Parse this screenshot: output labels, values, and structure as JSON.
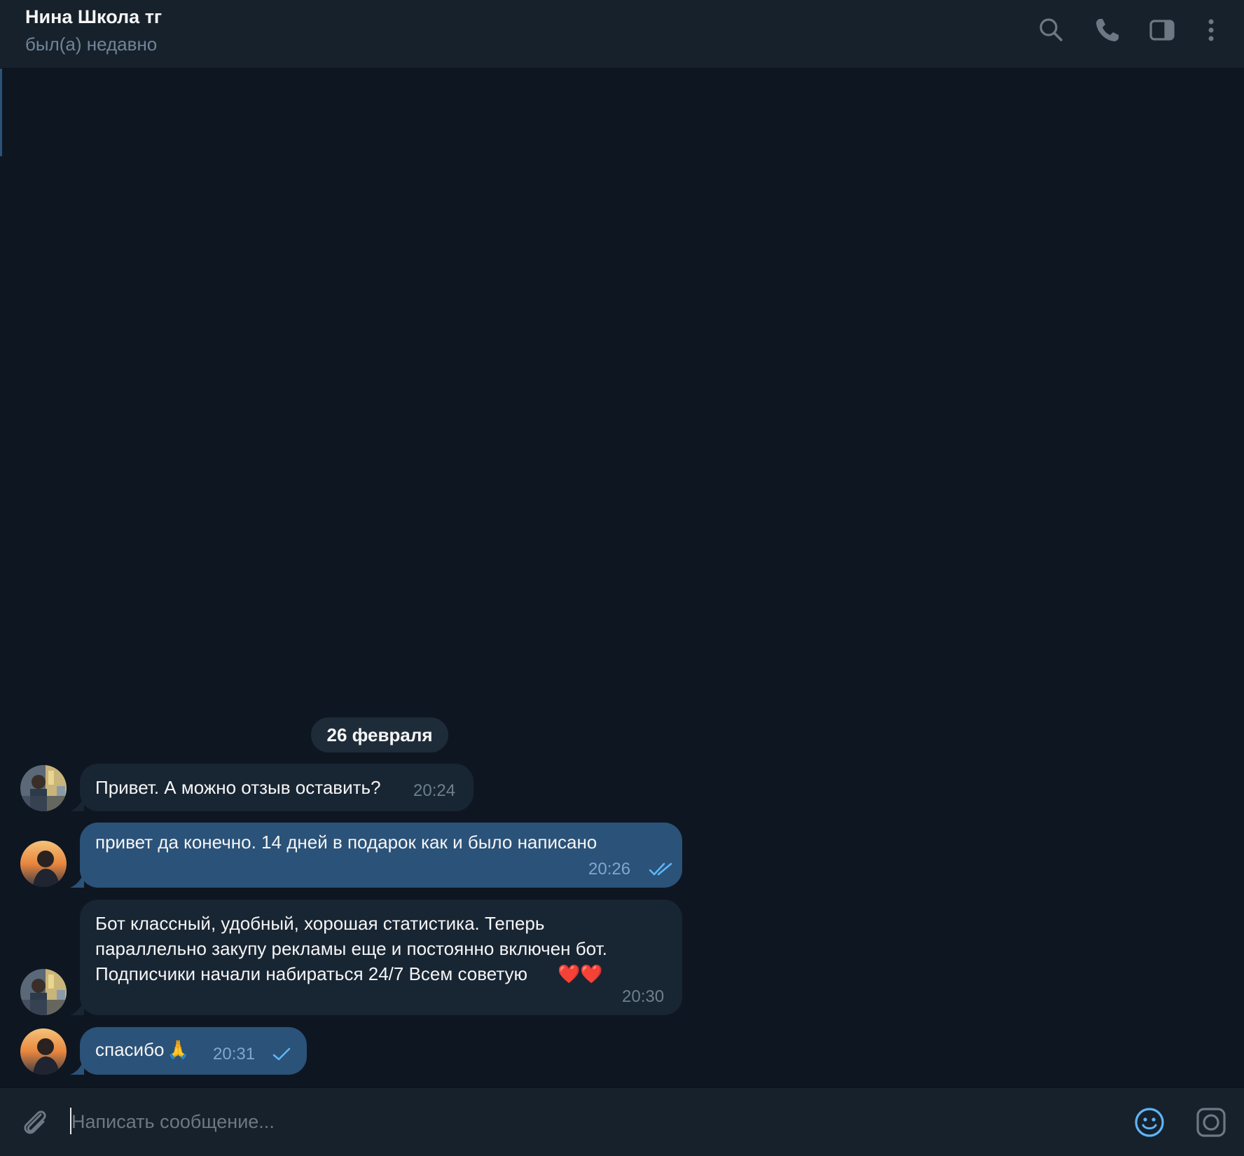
{
  "header": {
    "title": "Нина Школа тг",
    "status": "был(а) недавно",
    "icons": [
      "search-icon",
      "phone-icon",
      "sidebar-toggle-icon",
      "more-vert-icon"
    ]
  },
  "date_separator": "26 февраля",
  "messages": [
    {
      "direction": "incoming",
      "text": "Привет. А можно отзыв оставить?",
      "time": "20:24"
    },
    {
      "direction": "outgoing",
      "text": "привет да конечно. 14 дней в подарок как и было написано",
      "time": "20:26",
      "status": "read"
    },
    {
      "direction": "incoming",
      "lines": [
        "Бот классный, удобный, хорошая статистика. Теперь",
        "параллельно закупу рекламы еще и постоянно включен бот.",
        "Подписчики начали набираться 24/7 Всем советую"
      ],
      "emoji_suffix": "❤️❤️",
      "time": "20:30"
    },
    {
      "direction": "outgoing",
      "text": "спасибо",
      "emoji_suffix": "🙏",
      "time": "20:31",
      "status": "sent"
    }
  ],
  "composer": {
    "placeholder": "Написать сообщение...",
    "icons": [
      "attach-icon",
      "emoji-icon",
      "camera-icon"
    ]
  },
  "colors": {
    "background": "#0e1621",
    "header": "#17212b",
    "incoming_bubble": "#182533",
    "outgoing_bubble": "#2b5278",
    "accent": "#5eb5f7",
    "secondary_text": "#708499"
  }
}
